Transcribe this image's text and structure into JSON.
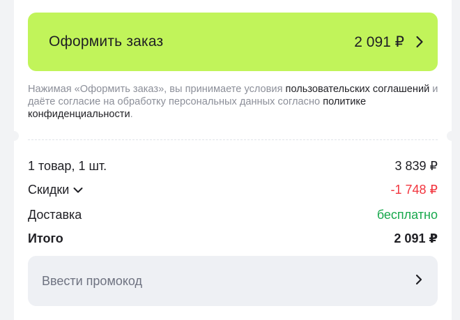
{
  "checkout": {
    "label": "Оформить заказ",
    "price": "2 091 ₽"
  },
  "terms": {
    "part1": "Нажимая «Оформить заказ», вы принимаете условия ",
    "link1": "пользовательских соглашений",
    "part2": " и даёте согласие на обработку персональных данных согласно ",
    "link2": "политике конфиденциальности",
    "part3": "."
  },
  "summary": {
    "items_label": "1 товар, 1 шт.",
    "items_value": "3 839 ₽",
    "discount_label": "Скидки",
    "discount_value": "-1 748 ₽",
    "delivery_label": "Доставка",
    "delivery_value": "бесплатно",
    "total_label": "Итого",
    "total_value": "2 091 ₽"
  },
  "promo": {
    "placeholder": "Ввести промокод"
  },
  "colors": {
    "accent": "#c1f45a",
    "discount": "#f2353e",
    "free": "#17a84c"
  },
  "icons": {
    "checkout_arrow": "chevron-right-icon",
    "discount_toggle": "chevron-down-icon",
    "promo_arrow": "chevron-right-icon"
  }
}
